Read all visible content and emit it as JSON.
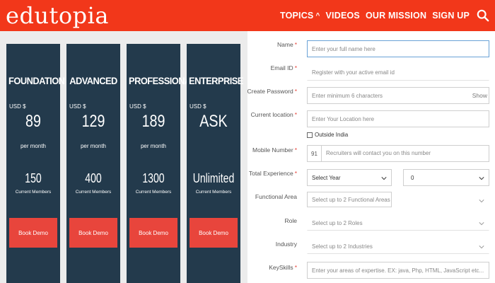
{
  "header": {
    "logo": "edutopia",
    "nav": [
      {
        "label": "TOPICS",
        "has_caret": true
      },
      {
        "label": "VIDEOS"
      },
      {
        "label": "OUR MISSION"
      },
      {
        "label": "SIGN UP"
      }
    ],
    "search_icon": "search-icon",
    "colors": {
      "brand": "#f2371a"
    }
  },
  "plans": [
    {
      "name": "FOUNDATION",
      "currency": "USD $",
      "price": "89",
      "period": "per month",
      "count": "150",
      "count_label": "Current Members",
      "button": "Book Demo"
    },
    {
      "name": "ADVANCED",
      "currency": "USD $",
      "price": "129",
      "period": "per month",
      "count": "400",
      "count_label": "Current Members",
      "button": "Book Demo"
    },
    {
      "name": "PROFESSIONAL",
      "currency": "USD $",
      "price": "189",
      "period": "per month",
      "count": "1300",
      "count_label": "Current Members",
      "button": "Book Demo"
    },
    {
      "name": "ENTERPRISE",
      "currency": "USD $",
      "price": "ASK",
      "period": "",
      "count": "Unlimited",
      "count_label": "Current Members",
      "button": "Book Demo"
    }
  ],
  "plan_colors": {
    "card": "#233a4c",
    "button": "#e8453c"
  },
  "form": {
    "name": {
      "label": "Name",
      "required": true,
      "placeholder": "Enter your full name here"
    },
    "email": {
      "label": "Email ID",
      "required": true,
      "placeholder": "Register with your active email id"
    },
    "password": {
      "label": "Create Password",
      "required": true,
      "placeholder": "Enter minimum 6 characters",
      "show": "Show"
    },
    "location": {
      "label": "Current location",
      "required": true,
      "placeholder": "Enter Your Location here"
    },
    "outside_india": {
      "label": "Outside India",
      "checked": false
    },
    "mobile": {
      "label": "Mobile Number",
      "required": true,
      "code": "91",
      "placeholder": "Recruiters will contact you on this number"
    },
    "experience": {
      "label": "Total Experience",
      "required": true,
      "year_value": "Select Year",
      "month_value": "0"
    },
    "functional_area": {
      "label": "Functional Area",
      "placeholder": "Select up to 2 Functional Areas"
    },
    "role": {
      "label": "Role",
      "placeholder": "Select up to 2 Roles"
    },
    "industry": {
      "label": "Industry",
      "placeholder": "Select up to 2 Industries"
    },
    "key_skills": {
      "label": "KeySkills",
      "required": true,
      "placeholder": "Enter your areas of expertise. EX: java, Php, HTML, JavaScript etc..."
    }
  }
}
